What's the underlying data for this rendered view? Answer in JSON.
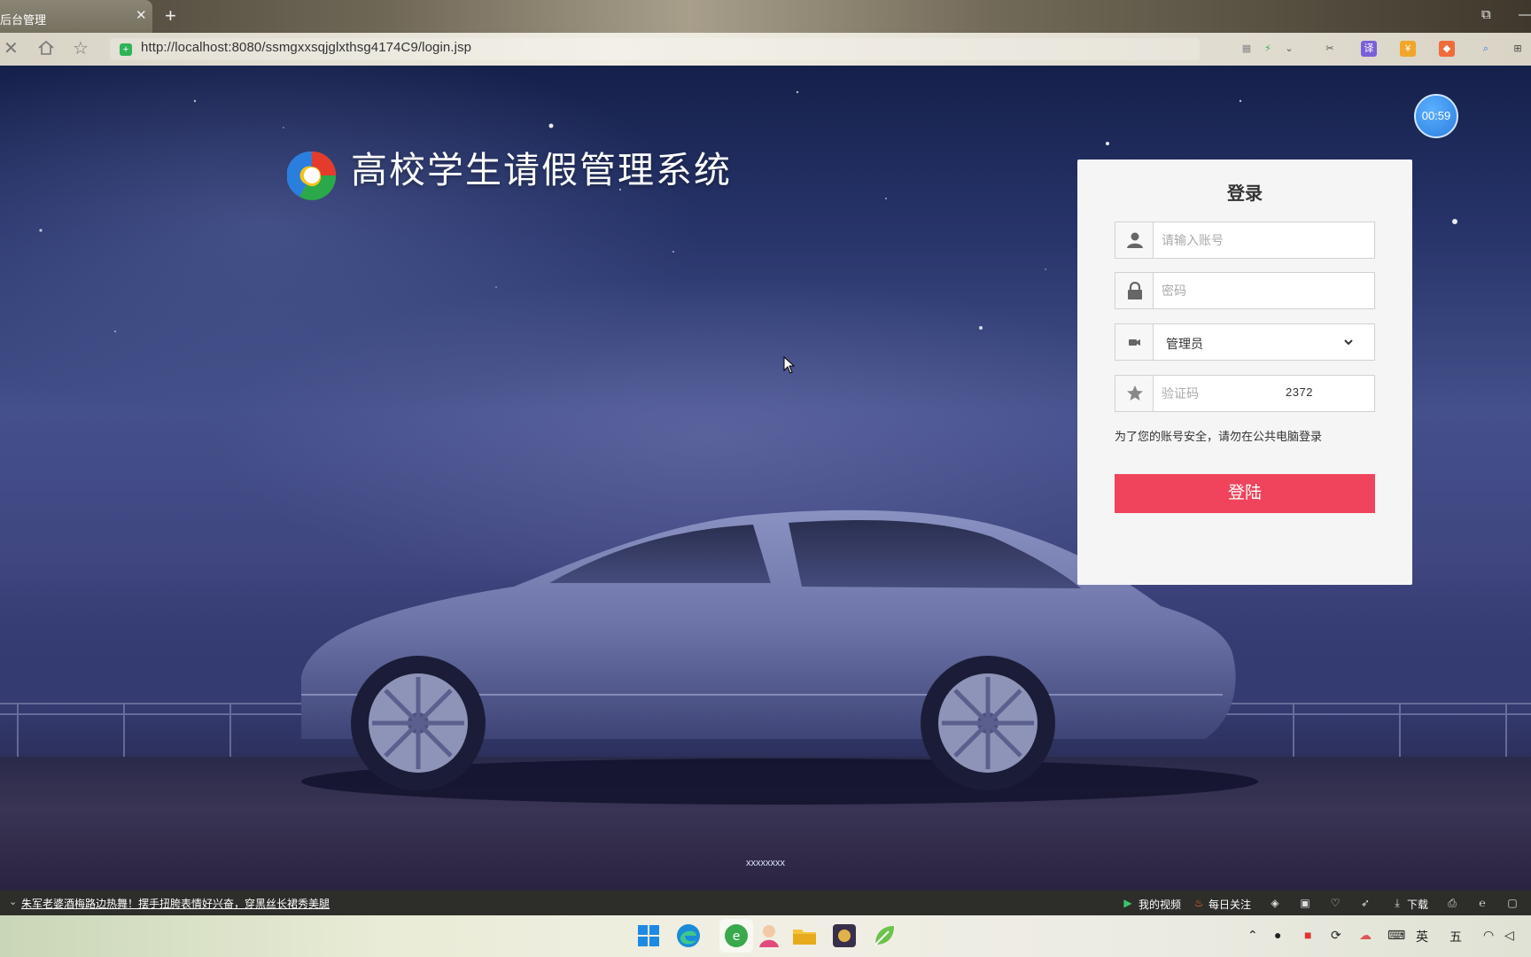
{
  "browser": {
    "tab_title": "后台管理",
    "url": "http://localhost:8080/ssmgxxsqjglxthsg4174C9/login.jsp"
  },
  "page": {
    "countdown": "00:59",
    "site_title": "高校学生请假管理系统",
    "footer": "xxxxxxxx"
  },
  "login": {
    "title": "登录",
    "username_placeholder": "请输入账号",
    "password_placeholder": "密码",
    "role_selected": "管理员",
    "captcha_placeholder": "验证码",
    "captcha_code": "2372",
    "notice": "为了您的账号安全，请勿在公共电脑登录",
    "submit_label": "登陆",
    "accent_color": "#f0445c"
  },
  "statusbar": {
    "news": "朱军老婆酒梅路边热舞！摆手扭胯表情好兴奋，穿黑丝长裙秀美腿",
    "my_video": "我的视频",
    "daily_follow": "每日关注",
    "download": "下载"
  },
  "taskbar": {
    "ime_lang": "英",
    "ime_mode": "五"
  }
}
